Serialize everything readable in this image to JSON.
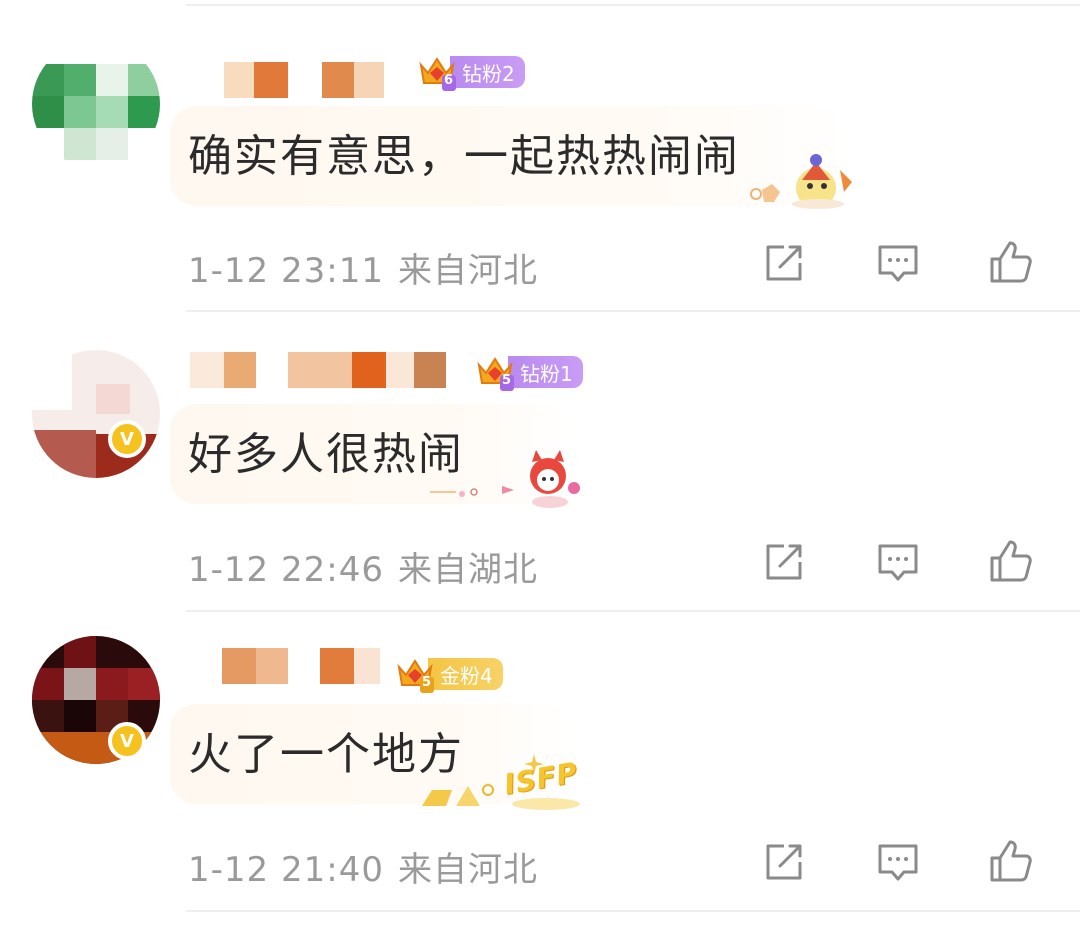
{
  "colors": {
    "divider": "#eeeeee",
    "text": "#2b2b2b",
    "meta": "#9a9a9a",
    "diamond_badge": "#c99cf5",
    "gold_badge": "#f4c543",
    "verified": "#f6c21f"
  },
  "comments": [
    {
      "fan_badge": {
        "level": "6",
        "label": "钻粉2",
        "style": "purple"
      },
      "text": "确实有意思，一起热热闹闹",
      "time": "1-12 23:11",
      "location": "来自河北",
      "verified": false,
      "actions": [
        "share-icon",
        "comment-icon",
        "like-icon"
      ]
    },
    {
      "fan_badge": {
        "level": "5",
        "label": "钻粉1",
        "style": "purple"
      },
      "text": "好多人很热闹",
      "time": "1-12 22:46",
      "location": "来自湖北",
      "verified": true,
      "verified_mark": "V",
      "actions": [
        "share-icon",
        "comment-icon",
        "like-icon"
      ]
    },
    {
      "fan_badge": {
        "level": "5",
        "label": "金粉4",
        "style": "gold"
      },
      "text": "火了一个地方",
      "time": "1-12 21:40",
      "location": "来自河北",
      "verified": true,
      "verified_mark": "V",
      "decoration_text": "ISFP",
      "actions": [
        "share-icon",
        "comment-icon",
        "like-icon"
      ]
    }
  ]
}
